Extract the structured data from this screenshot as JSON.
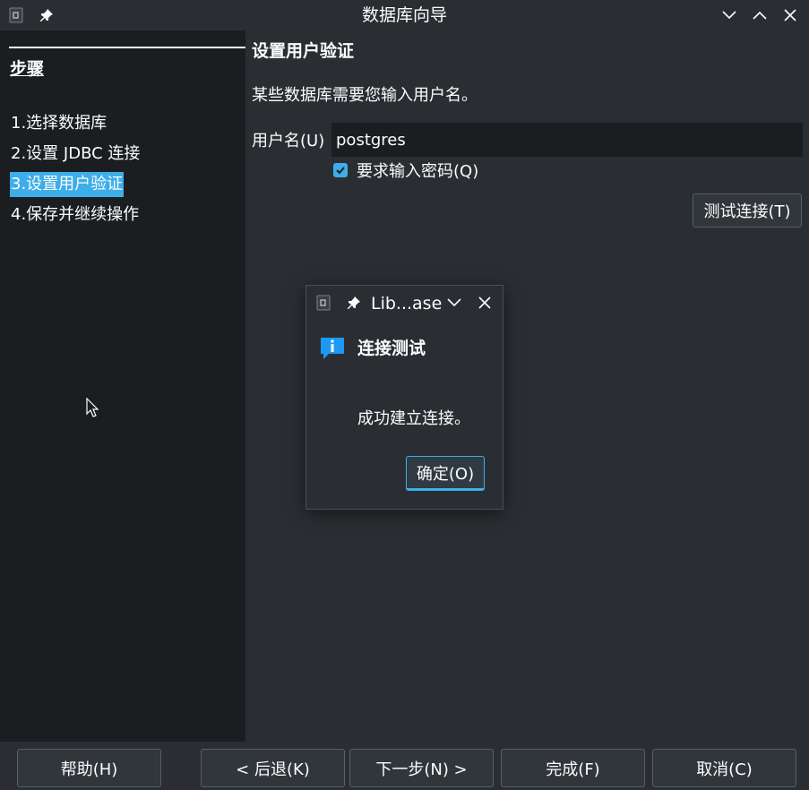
{
  "window": {
    "title": "数据库向导"
  },
  "steps": {
    "heading": "步骤",
    "items": [
      {
        "label": "1.选择数据库"
      },
      {
        "label": "2.设置 JDBC 连接"
      },
      {
        "label": "3.设置用户验证"
      },
      {
        "label": "4.保存并继续操作"
      }
    ]
  },
  "main": {
    "section_title": "设置用户验证",
    "description": "某些数据库需要您输入用户名。",
    "username_label": "用户名(U)",
    "username_value": "postgres",
    "password_checkbox_label": "要求输入密码(Q)",
    "password_checked": true,
    "test_button": "测试连接(T)"
  },
  "buttons": {
    "help": "帮助(H)",
    "back": "< 后退(K)",
    "next": "下一步(N) >",
    "finish": "完成(F)",
    "cancel": "取消(C)"
  },
  "dialog": {
    "title": "Lib...ase",
    "heading": "连接测试",
    "message": "成功建立连接。",
    "ok_button": "确定(O)"
  },
  "colors": {
    "accent": "#3daee9",
    "background": "#2a2e32",
    "panel": "#1b1e20"
  }
}
